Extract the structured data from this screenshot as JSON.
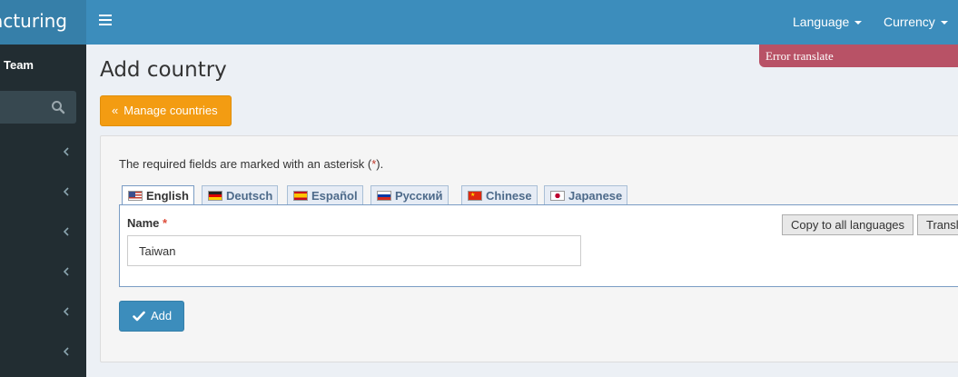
{
  "brand": {
    "logo_text": "facturing"
  },
  "user": {
    "name": "Team"
  },
  "sidebar": {
    "menu_count": 6
  },
  "navbar": {
    "language_label": "Language",
    "currency_label": "Currency"
  },
  "toast": {
    "message": "Error translate"
  },
  "page": {
    "title": "Add country",
    "manage_label": "Manage countries"
  },
  "form": {
    "required_note_prefix": "The required fields are marked with an asterisk (",
    "required_note_asterisk": "*",
    "required_note_suffix": ").",
    "tabs": [
      {
        "label": "English",
        "flag": "us"
      },
      {
        "label": "Deutsch",
        "flag": "de"
      },
      {
        "label": "Español",
        "flag": "es"
      },
      {
        "label": "Русский",
        "flag": "ru"
      },
      {
        "label": "Chinese",
        "flag": "cn"
      },
      {
        "label": "Japanese",
        "flag": "jp"
      }
    ],
    "name_label": "Name",
    "name_asterisk": "*",
    "name_value": "Taiwan",
    "copy_label": "Copy to all languages",
    "translate_label": "Translate",
    "submit_label": "Add"
  },
  "colors": {
    "header": "#3c8dbc",
    "logo_bg": "#367fa9",
    "sidebar": "#222d32",
    "warning": "#f39c12",
    "toast": "#b85266"
  }
}
